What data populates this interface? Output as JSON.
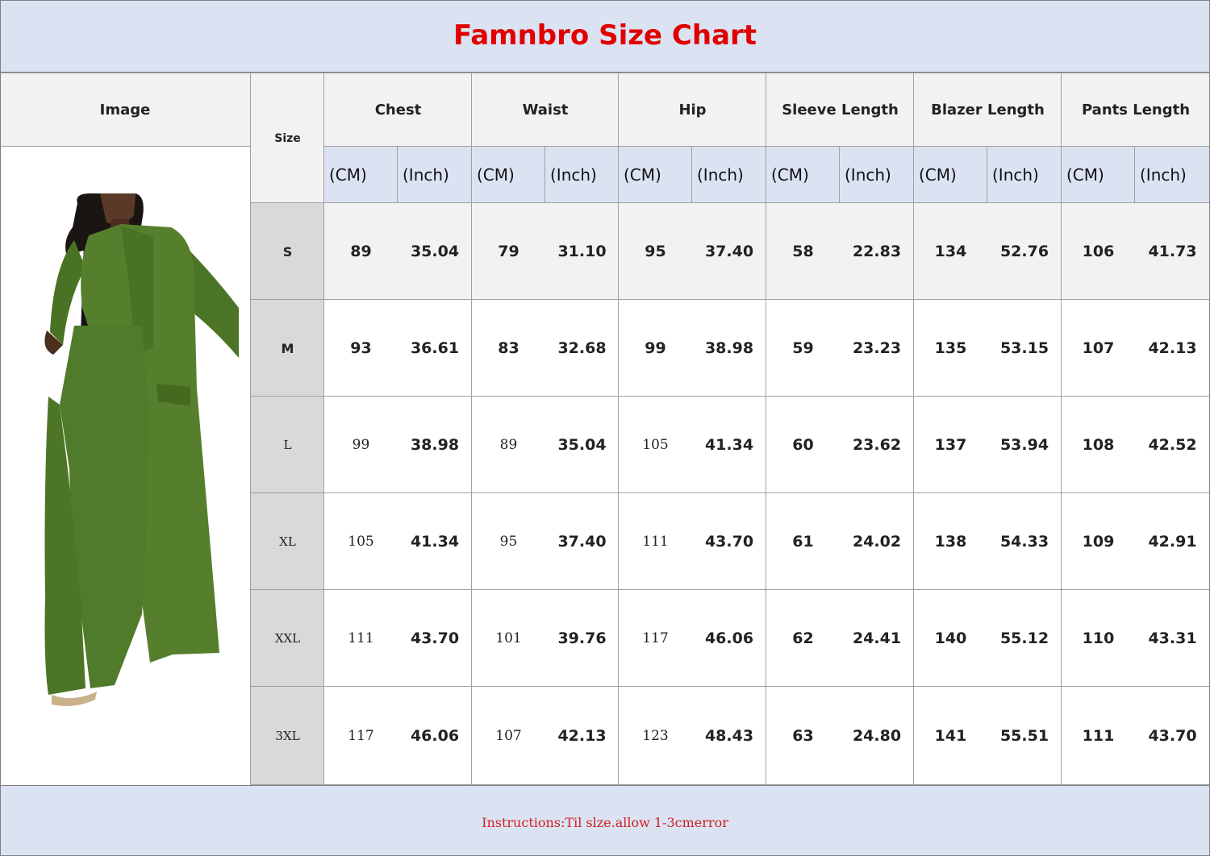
{
  "title": "Famnbro Size Chart",
  "footer": "Instructions:Til slze.allow 1-3cmerror",
  "colors": {
    "header_band": "#dbe3f3",
    "title": "#e00000",
    "size_col": "#d9d9d9",
    "garment_green": "#4f7a2a"
  },
  "table": {
    "image_header": "Image",
    "size_header": "Size",
    "groups": [
      "Chest",
      "Waist",
      "Hip",
      "Sleeve Length",
      "Blazer Length",
      "Pants  Length"
    ],
    "units": [
      "(CM)",
      "(Inch)"
    ],
    "rows": [
      {
        "size": "S",
        "values": [
          "89",
          "35.04",
          "79",
          "31.10",
          "95",
          "37.40",
          "58",
          "22.83",
          "134",
          "52.76",
          "106",
          "41.73"
        ]
      },
      {
        "size": "M",
        "values": [
          "93",
          "36.61",
          "83",
          "32.68",
          "99",
          "38.98",
          "59",
          "23.23",
          "135",
          "53.15",
          "107",
          "42.13"
        ]
      },
      {
        "size": "L",
        "values": [
          "99",
          "38.98",
          "89",
          "35.04",
          "105",
          "41.34",
          "60",
          "23.62",
          "137",
          "53.94",
          "108",
          "42.52"
        ]
      },
      {
        "size": "XL",
        "values": [
          "105",
          "41.34",
          "95",
          "37.40",
          "111",
          "43.70",
          "61",
          "24.02",
          "138",
          "54.33",
          "109",
          "42.91"
        ]
      },
      {
        "size": "XXL",
        "values": [
          "111",
          "43.70",
          "101",
          "39.76",
          "117",
          "46.06",
          "62",
          "24.41",
          "140",
          "55.12",
          "110",
          "43.31"
        ]
      },
      {
        "size": "3XL",
        "values": [
          "117",
          "46.06",
          "107",
          "42.13",
          "123",
          "48.43",
          "63",
          "24.80",
          "141",
          "55.51",
          "111",
          "43.70"
        ]
      }
    ]
  },
  "image": {
    "icon": "model-photo-green-blazer-suit"
  }
}
